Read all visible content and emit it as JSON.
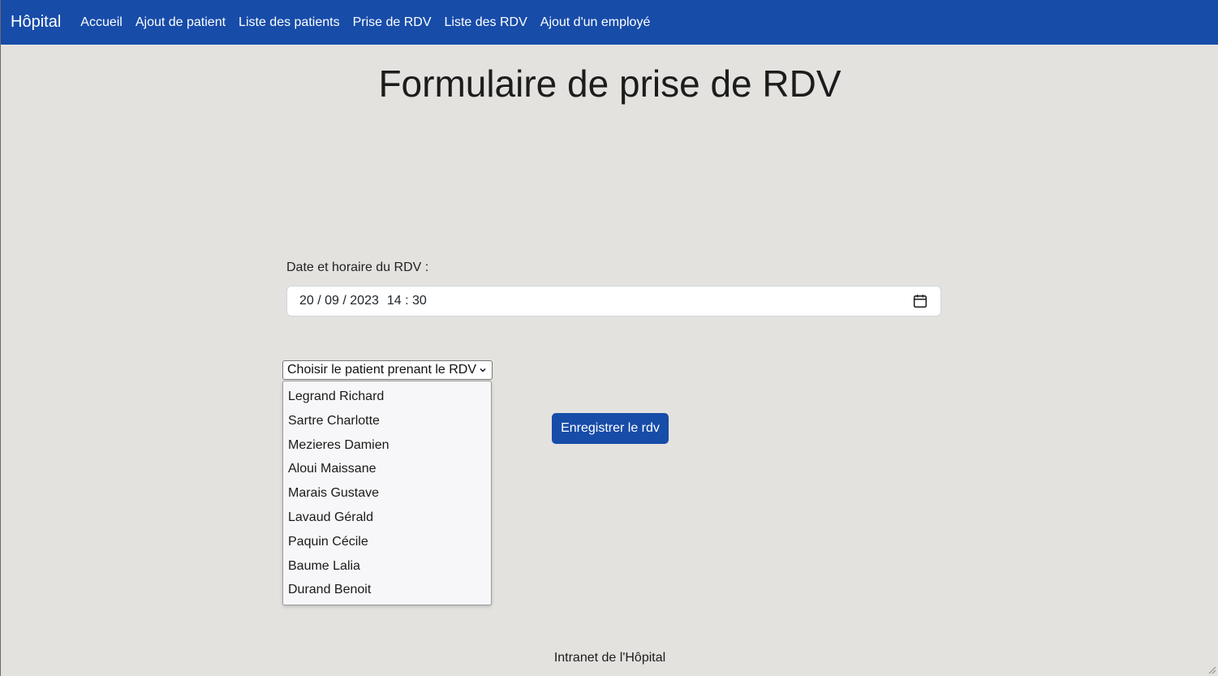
{
  "nav": {
    "brand": "Hôpital",
    "links": [
      "Accueil",
      "Ajout de patient",
      "Liste des patients",
      "Prise de RDV",
      "Liste des RDV",
      "Ajout d'un employé"
    ]
  },
  "page": {
    "title": "Formulaire de prise de RDV"
  },
  "form": {
    "date_label": "Date et horaire du RDV :",
    "date_value": "20 / 09 / 2023",
    "time_value": "14 : 30",
    "patient_select_label": "Choisir le patient prenant le RDV",
    "patients": [
      "Legrand Richard",
      "Sartre Charlotte",
      "Mezieres Damien",
      "Aloui Maissane",
      "Marais Gustave",
      "Lavaud Gérald",
      "Paquin Cécile",
      "Baume Lalia",
      "Durand Benoit"
    ],
    "submit_label": "Enregistrer le rdv"
  },
  "footer": {
    "text": "Intranet de l'Hôpital"
  },
  "colors": {
    "navbar": "#174ca9",
    "background": "#e3e2df",
    "button": "#174ca9"
  }
}
